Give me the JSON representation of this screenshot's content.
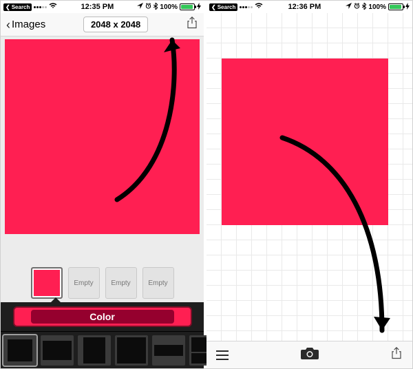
{
  "left": {
    "status": {
      "search_label": "Search",
      "time": "12:35 PM",
      "battery_pct": "100%"
    },
    "nav": {
      "back_label": "Images",
      "dimensions": "2048 x 2048"
    },
    "canvas": {
      "color_hex": "#ff1f52"
    },
    "swatches": {
      "items": [
        {
          "label": "",
          "filled": true,
          "selected": true
        },
        {
          "label": "Empty",
          "filled": false
        },
        {
          "label": "Empty",
          "filled": false
        },
        {
          "label": "Empty",
          "filled": false
        }
      ]
    },
    "color_button_label": "Color",
    "template_count": 6
  },
  "right": {
    "status": {
      "search_label": "Search",
      "time": "12:36 PM",
      "battery_pct": "100%"
    },
    "canvas": {
      "color_hex": "#ff1f52"
    }
  }
}
